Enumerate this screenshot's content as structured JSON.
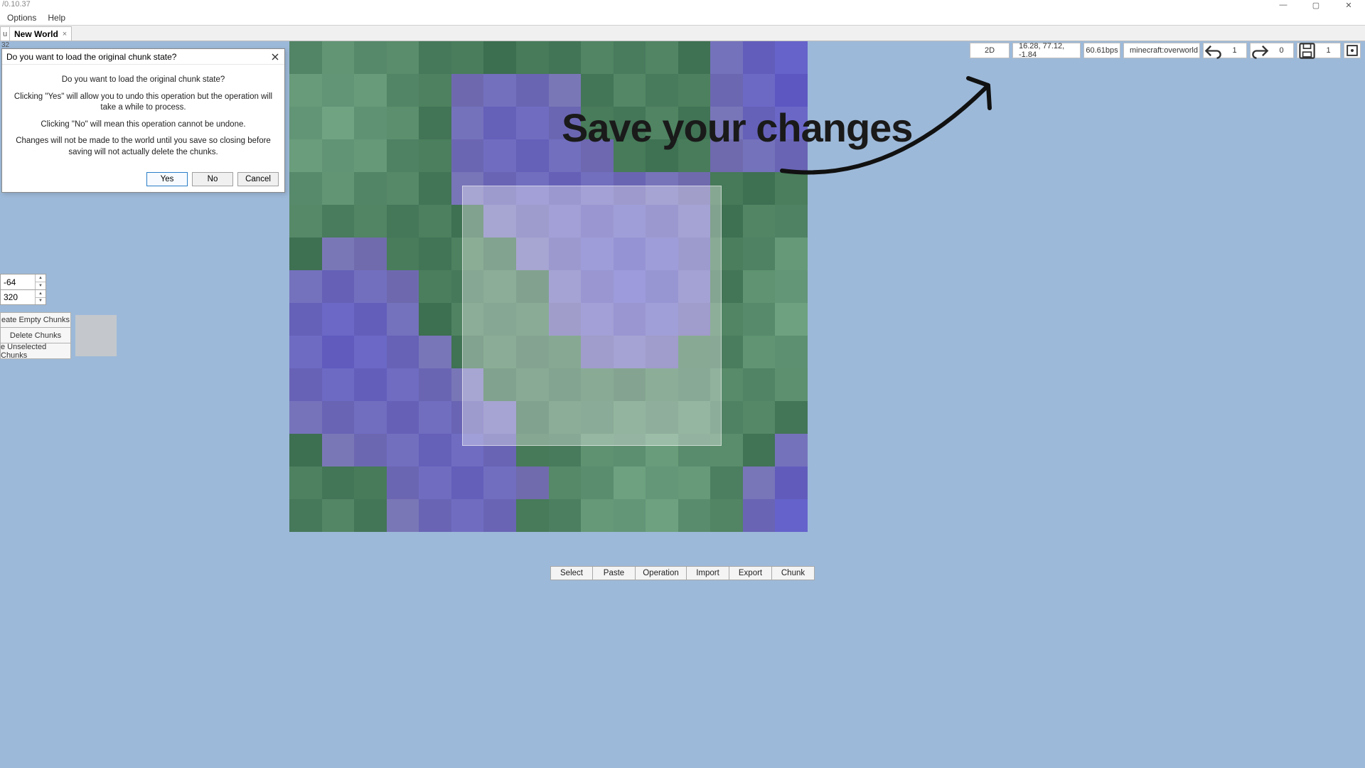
{
  "window": {
    "title": "/0.10.37"
  },
  "menu": {
    "options": "Options",
    "help": "Help"
  },
  "tabs": {
    "stub": "u",
    "active": "New World",
    "close_glyph": "×"
  },
  "corner_num": "32",
  "toolbar": {
    "mode": "2D",
    "coords": "16.28, 77.12, -1.84",
    "bps": "60.61bps",
    "dimension": "minecraft:overworld",
    "undo_count": "1",
    "redo_count": "0",
    "save_count": "1"
  },
  "left_panel": {
    "min_y": "-64",
    "max_y": "320",
    "btn1": "eate Empty Chunks",
    "btn2": "Delete Chunks",
    "btn3": "e Unselected Chunks"
  },
  "dialog": {
    "title": "Do you want to load the original chunk state?",
    "line1": "Do you want to load the original chunk state?",
    "line2": "Clicking \"Yes\" will allow you to undo this operation but the operation will take a while to process.",
    "line3": "Clicking \"No\" will mean this operation cannot be undone.",
    "line4": "Changes will not be made to the world until you save so closing before saving will not actually delete the chunks.",
    "yes": "Yes",
    "no": "No",
    "cancel": "Cancel"
  },
  "bottom": {
    "select": "Select",
    "paste": "Paste",
    "operation": "Operation",
    "import": "Import",
    "export": "Export",
    "chunk": "Chunk"
  },
  "annotation": {
    "text": "Save your changes"
  }
}
